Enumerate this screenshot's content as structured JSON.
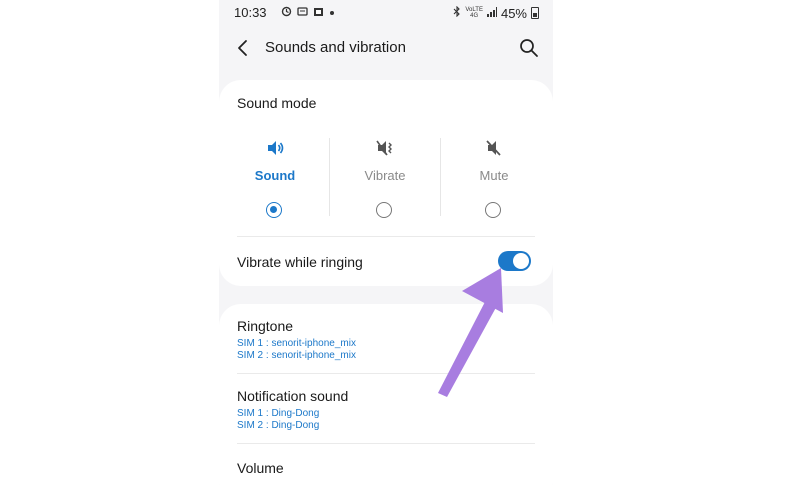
{
  "status_bar": {
    "time": "10:33",
    "network_top": "VoLTE",
    "network_mid": "4G",
    "battery": "45%"
  },
  "header": {
    "title": "Sounds and vibration"
  },
  "sound_mode": {
    "title": "Sound mode",
    "options": [
      {
        "label": "Sound",
        "icon": "speaker-icon",
        "selected": true
      },
      {
        "label": "Vibrate",
        "icon": "vibrate-icon",
        "selected": false
      },
      {
        "label": "Mute",
        "icon": "mute-icon",
        "selected": false
      }
    ],
    "vibrate_while_ringing": {
      "label": "Vibrate while ringing",
      "enabled": true
    }
  },
  "settings": [
    {
      "title": "Ringtone",
      "sim1": "SIM 1 : senorit-iphone_mix",
      "sim2": "SIM 2 : senorit-iphone_mix"
    },
    {
      "title": "Notification sound",
      "sim1": "SIM 1 : Ding-Dong",
      "sim2": "SIM 2 : Ding-Dong"
    },
    {
      "title": "Volume"
    }
  ],
  "colors": {
    "accent": "#1c78c9",
    "annotation_arrow": "#a87de0",
    "background": "#f5f5f7"
  }
}
